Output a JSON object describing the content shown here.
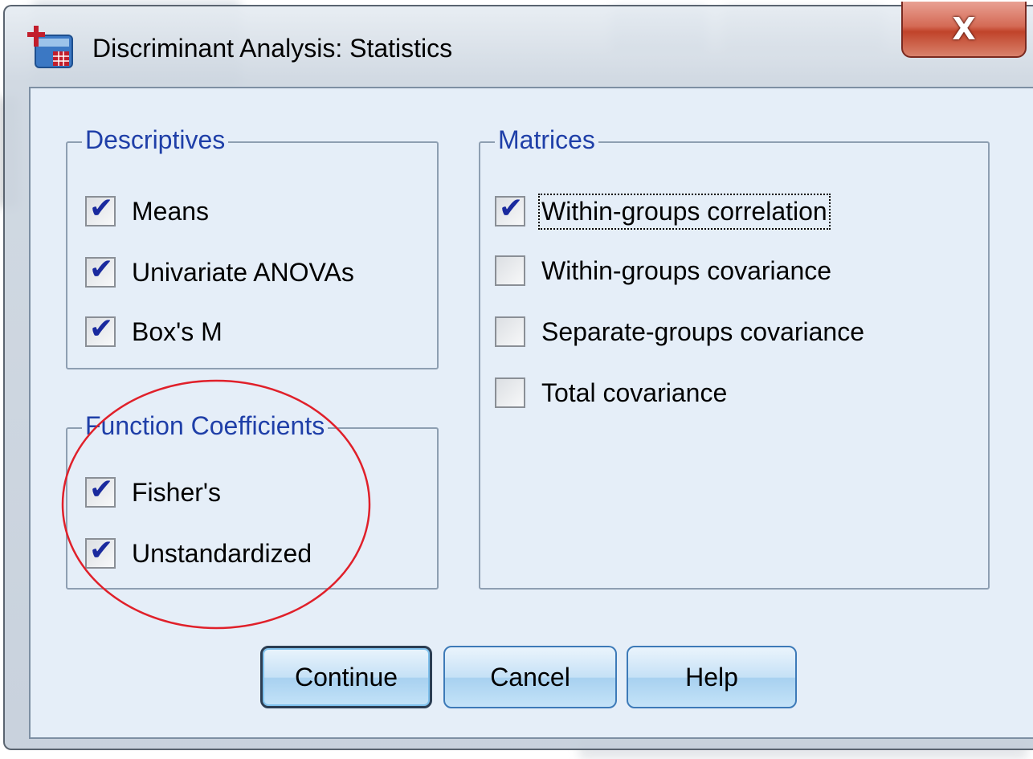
{
  "window": {
    "title": "Discriminant Analysis: Statistics",
    "close_glyph": "X"
  },
  "descriptives": {
    "legend": "Descriptives",
    "items": [
      {
        "label": "Means",
        "checked": true
      },
      {
        "label": "Univariate ANOVAs",
        "checked": true
      },
      {
        "label": "Box's M",
        "checked": true
      }
    ]
  },
  "function_coefficients": {
    "legend": "Function Coefficients",
    "items": [
      {
        "label": "Fisher's",
        "checked": true
      },
      {
        "label": "Unstandardized",
        "checked": true
      }
    ]
  },
  "matrices": {
    "legend": "Matrices",
    "items": [
      {
        "label": "Within-groups correlation",
        "checked": true
      },
      {
        "label": "Within-groups covariance",
        "checked": false
      },
      {
        "label": "Separate-groups covariance",
        "checked": false
      },
      {
        "label": "Total covariance",
        "checked": false
      }
    ]
  },
  "buttons": {
    "continue": "Continue",
    "cancel": "Cancel",
    "help": "Help"
  },
  "colors": {
    "legend_text": "#1f3fa8",
    "checkmark": "#1a2a9e",
    "annotation_circle": "#e0202a",
    "client_background": "#e5eef8"
  }
}
